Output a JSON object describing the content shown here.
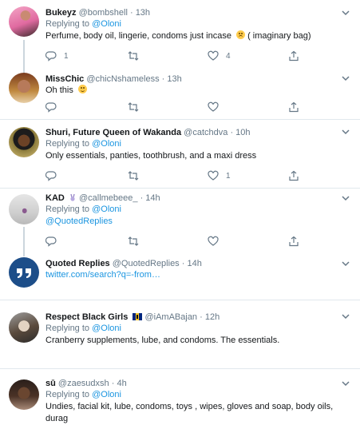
{
  "tweets": [
    {
      "name": "Bukeyz",
      "handle": "@bombshell",
      "time": "· 13h",
      "replying_label": "Replying to",
      "replying_handle": "@Oloni",
      "text": "Perfume, body oil, lingerie, condoms just incase",
      "text_after_emoji": " ( imaginary bag)",
      "emoji": "upside-down-face",
      "reply_count": "1",
      "retweet_count": "",
      "like_count": "4"
    },
    {
      "name": "MissChic",
      "handle": "@chicNshameless",
      "time": "· 13h",
      "text": "Oh this",
      "emoji": "smiling-face"
    },
    {
      "name": "Shuri, Future Queen of Wakanda",
      "handle": "@catchdva",
      "time": "· 10h",
      "replying_label": "Replying to",
      "replying_handle": "@Oloni",
      "text": "Only essentials, panties, toothbrush, and a maxi dress",
      "like_count": "1"
    },
    {
      "name": "KAD",
      "name_icon": "rabbit-emoji",
      "handle": "@callmebeee_",
      "time": "· 14h",
      "replying_label": "Replying to",
      "replying_handle": "@Oloni",
      "text_link": "@QuotedReplies"
    },
    {
      "name": "Quoted Replies",
      "handle": "@QuotedReplies",
      "time": "· 14h",
      "text_link": "twitter.com/search?q=-from…"
    },
    {
      "name": "Respect Black Girls",
      "name_icon": "barbados-flag",
      "handle": "@iAmABajan",
      "time": "· 12h",
      "replying_label": "Replying to",
      "replying_handle": "@Oloni",
      "text": "Cranberry supplements, lube, and condoms. The essentials."
    },
    {
      "name": "sū",
      "handle": "@zaesudxsh",
      "time": "· 4h",
      "replying_label": "Replying to",
      "replying_handle": "@Oloni",
      "text_line1": "Undies, facial kit, lube, condoms, toys , wipes, gloves and soap, body oils,",
      "text_line2": "durag"
    }
  ],
  "icons": {
    "reply": "reply-icon",
    "retweet": "retweet-icon",
    "like": "heart-icon",
    "share": "share-icon",
    "caret": "chevron-down-icon"
  },
  "colors": {
    "link": "#1b95e0",
    "muted": "#657786",
    "text": "#14171a",
    "divider": "#e1e8ed",
    "thread": "#ccd6dd"
  }
}
